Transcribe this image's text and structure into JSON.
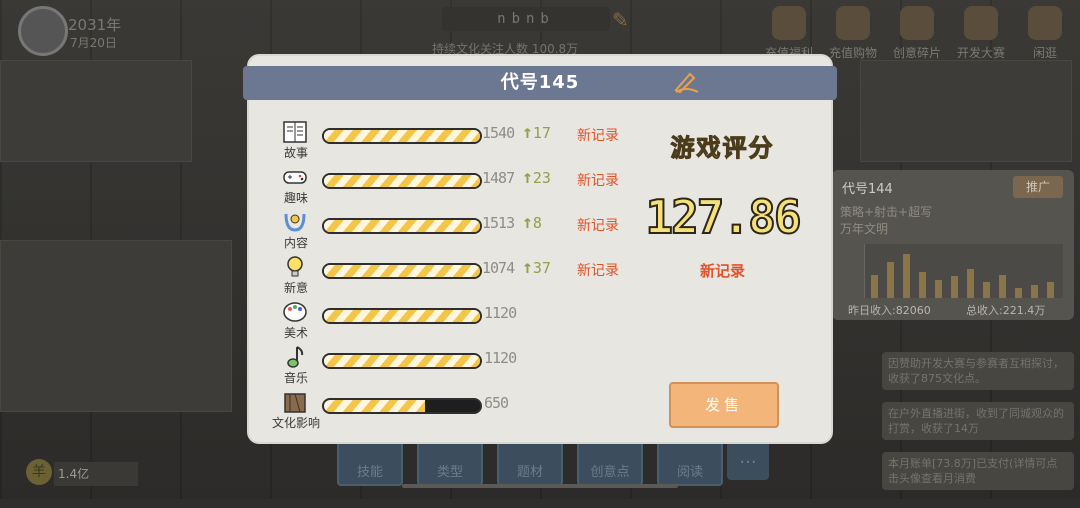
{
  "background": {
    "date_year": "2031年",
    "date_day": "7月20日",
    "name_field": "nbnb",
    "follower_text": "持续文化关注人数 100.8万",
    "top_icons": [
      {
        "icon": "gift-icon",
        "label": "充值福利"
      },
      {
        "icon": "shop-icon",
        "label": "充值购物"
      },
      {
        "icon": "shard-icon",
        "label": "创意碎片"
      },
      {
        "icon": "code-icon",
        "label": "开发大赛"
      },
      {
        "icon": "tree-icon",
        "label": "闲逛"
      }
    ],
    "right_panel": {
      "title": "代号144",
      "promote": "推广",
      "sub1": "策略+射击+超写",
      "sub2": "万年文明",
      "yesterday_income": "昨日收入:82060",
      "total_income": "总收入:221.4万",
      "chart_levels": [
        0.45,
        0.7,
        0.85,
        0.5,
        0.35,
        0.42,
        0.55,
        0.3,
        0.45,
        0.2,
        0.25,
        0.3
      ]
    },
    "news": [
      "因赞助开发大赛与参赛者互相探讨，收获了875文化点。",
      "在户外直播进街，收到了同城观众的打赏，收获了14万",
      "本月账单[73.8万]已支付(详情可点击头像查看月消费"
    ],
    "money": "1.4亿",
    "coin_symbol": "羊",
    "tabs": [
      "技能",
      "类型",
      "题材",
      "创意点",
      "阅读"
    ],
    "more": "..."
  },
  "dialog": {
    "title": "代号145",
    "stats": [
      {
        "icon": "story-book-icon",
        "label": "故事",
        "value": "1540",
        "increase": "17",
        "record": "新记录",
        "fill": 1.0
      },
      {
        "icon": "gamepad-icon",
        "label": "趣味",
        "value": "1487",
        "increase": "23",
        "record": "新记录",
        "fill": 1.0
      },
      {
        "icon": "content-icon",
        "label": "内容",
        "value": "1513",
        "increase": "8",
        "record": "新记录",
        "fill": 1.0
      },
      {
        "icon": "lightbulb-icon",
        "label": "新意",
        "value": "1074",
        "increase": "37",
        "record": "新记录",
        "fill": 1.0
      },
      {
        "icon": "palette-icon",
        "label": "美术",
        "value": "1120",
        "increase": "",
        "record": "",
        "fill": 1.0
      },
      {
        "icon": "music-note-icon",
        "label": "音乐",
        "value": "1120",
        "increase": "",
        "record": "",
        "fill": 1.0
      },
      {
        "icon": "culture-book-icon",
        "label": "文化影响",
        "value": "650",
        "increase": "",
        "record": "",
        "fill": 0.65
      }
    ],
    "score_label": "游戏评分",
    "score": "127.86",
    "score_record": "新记录",
    "sell_button": "发售",
    "colors": {
      "accent": "#6c7892",
      "record": "#e0542b",
      "increase": "#8ea34a",
      "bar": "#f3c64a",
      "score": "#f6e07a"
    }
  }
}
